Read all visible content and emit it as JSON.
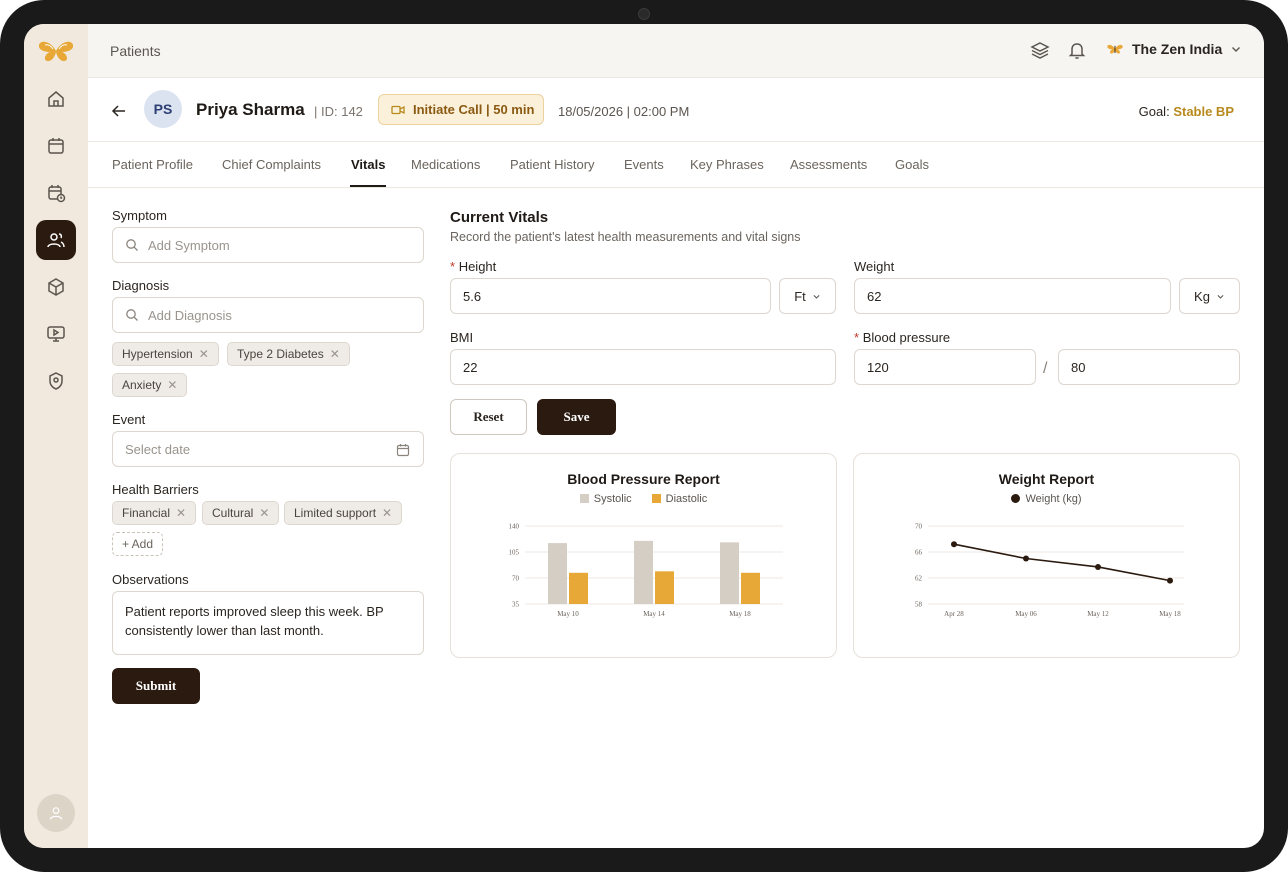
{
  "topbar": {
    "breadcrumb": "Patients",
    "org_name": "The Zen India"
  },
  "patient": {
    "initials": "PS",
    "name": "Priya Sharma",
    "id_text": "| ID: 142",
    "call_label": "Initiate Call | 50 min",
    "datetime": "18/05/2026 | 02:00 PM",
    "goal_label": "Goal:",
    "goal_value": "Stable BP"
  },
  "tabs": [
    "Patient Profile",
    "Chief Complaints",
    "Vitals",
    "Medications",
    "Patient History",
    "Events",
    "Key Phrases",
    "Assessments",
    "Goals"
  ],
  "active_tab": "Vitals",
  "left_form": {
    "symptom_label": "Symptom",
    "symptom_placeholder": "Add Symptom",
    "diagnosis_label": "Diagnosis",
    "diagnosis_placeholder": "Add Diagnosis",
    "diagnosis_chips": [
      "Hypertension",
      "Type 2 Diabetes",
      "Anxiety"
    ],
    "event_label": "Event",
    "event_placeholder": "Select date",
    "barriers_label": "Health Barriers",
    "barrier_chips": [
      "Financial",
      "Cultural",
      "Limited support"
    ],
    "add_label": "+ Add",
    "observations_label": "Observations",
    "observations_text": "Patient reports improved sleep this week. BP consistently lower than last month.",
    "submit_label": "Submit"
  },
  "vitals": {
    "title": "Current Vitals",
    "subtitle": "Record the patient's latest health measurements and vital signs",
    "height_label": "Height",
    "height_value": "5.6",
    "height_unit": "Ft",
    "weight_label": "Weight",
    "weight_value": "62",
    "weight_unit": "Kg",
    "bmi_label": "BMI",
    "bmi_value": "22",
    "bp_label": "Blood pressure",
    "bp_systolic": "120",
    "bp_diastolic": "80",
    "slash": "/",
    "reset_label": "Reset",
    "save_label": "Save"
  },
  "colors": {
    "accent_dark": "#2a1a0f",
    "systolic": "#d5cec4",
    "diastolic": "#e8a838",
    "goal": "#b88a1e"
  },
  "chart_data": [
    {
      "type": "bar",
      "title": "Blood Pressure Report",
      "categories": [
        "May 10",
        "May 14",
        "May 18"
      ],
      "series": [
        {
          "name": "Systolic",
          "values": [
            117,
            120,
            118
          ]
        },
        {
          "name": "Diastolic",
          "values": [
            77,
            79,
            77
          ]
        }
      ],
      "yticks": [
        35,
        70,
        105,
        140
      ],
      "ylim": [
        35,
        140
      ],
      "grid": true,
      "legend": "top-center"
    },
    {
      "type": "line",
      "title": "Weight Report",
      "categories": [
        "Apr 28",
        "May 06",
        "May 12",
        "May 18"
      ],
      "series": [
        {
          "name": "Weight (kg)",
          "values": [
            67.2,
            65,
            63.7,
            61.6
          ]
        }
      ],
      "yticks": [
        58,
        62,
        66,
        70
      ],
      "ylim": [
        58,
        70
      ],
      "grid": true,
      "legend": "top-center"
    }
  ]
}
